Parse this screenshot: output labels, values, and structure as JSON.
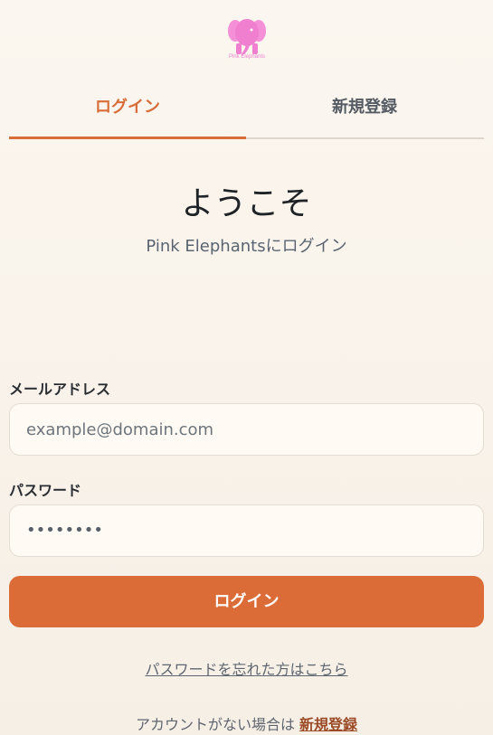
{
  "brand": {
    "name": "Pink Elephants",
    "logo_icon": "elephant-icon",
    "logo_color": "#f07fcf"
  },
  "tabs": [
    {
      "label": "ログイン",
      "active": true
    },
    {
      "label": "新規登録",
      "active": false
    }
  ],
  "header": {
    "title": "ようこそ",
    "subtitle": "Pink Elephantsにログイン"
  },
  "form": {
    "email_label": "メールアドレス",
    "email_placeholder": "example@domain.com",
    "email_value": "",
    "password_label": "パスワード",
    "password_value": "••••••••"
  },
  "actions": {
    "login_button": "ログイン",
    "forgot_link": "パスワードを忘れた方はこちら",
    "no_account_text": "アカウントがない場合は",
    "signup_link": "新規登録"
  },
  "colors": {
    "accent": "#db6b37",
    "background": "#fbf6ef",
    "link": "#9a4a25"
  }
}
